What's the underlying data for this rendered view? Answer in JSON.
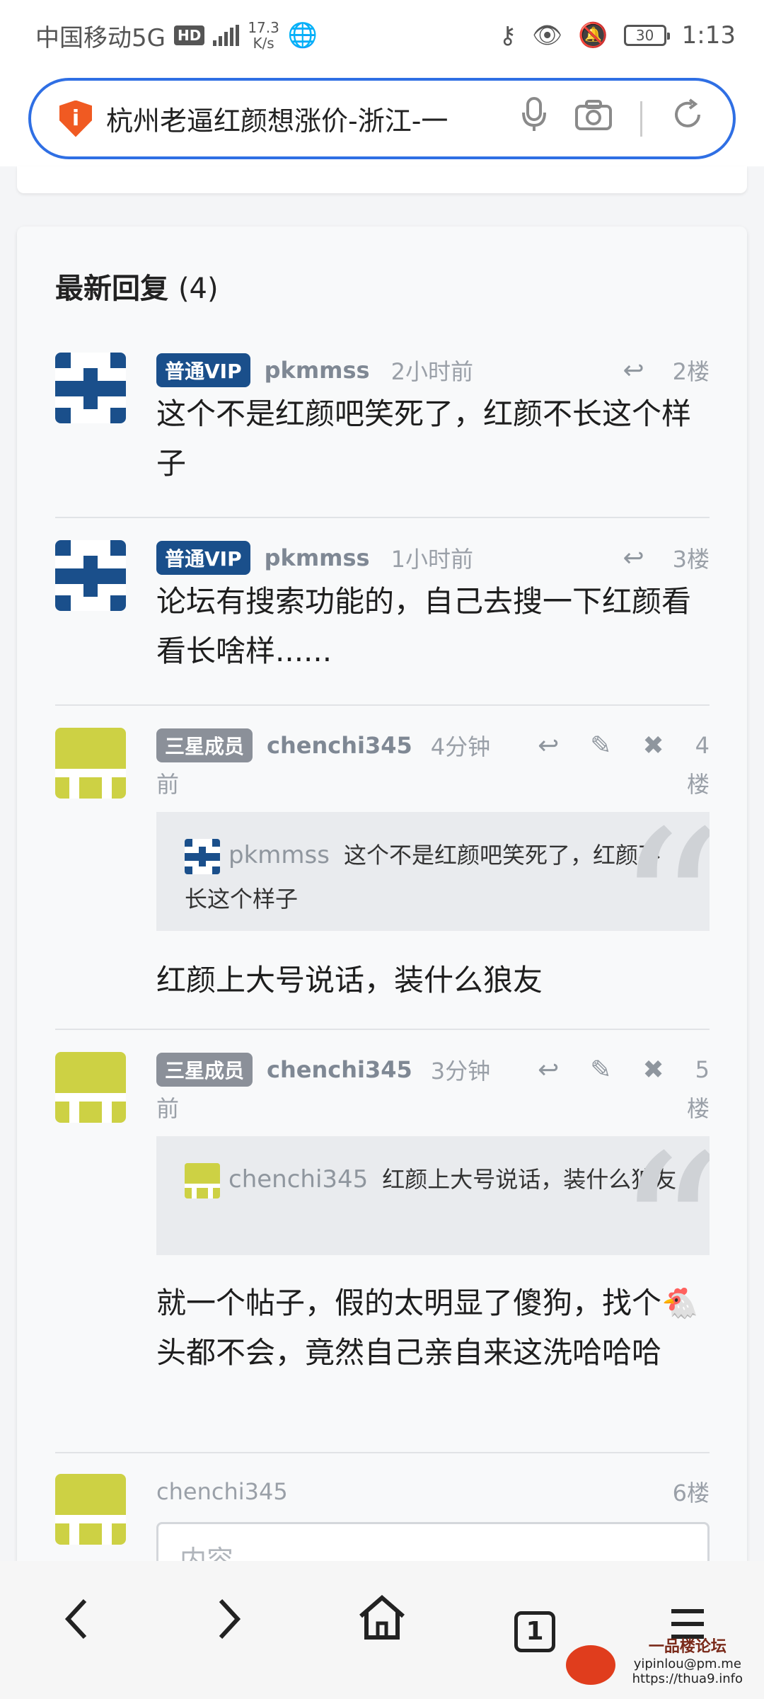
{
  "status": {
    "carrier": "中国移动5G",
    "hd": "HD",
    "net_speed_value": "17.3",
    "net_speed_unit": "K/s",
    "battery": "30",
    "time": "1:13"
  },
  "address_bar": {
    "url_title": "杭州老逼红颜想涨价-浙江-一"
  },
  "replies": {
    "title": "最新回复",
    "count": "(4)"
  },
  "posts": [
    {
      "badge": "普通VIP",
      "user": "pkmmss",
      "time": "2小时前",
      "floor": "2楼",
      "text": "这个不是红颜吧笑死了，红颜不长这个样子"
    },
    {
      "badge": "普通VIP",
      "user": "pkmmss",
      "time": "1小时前",
      "floor": "3楼",
      "text": "论坛有搜索功能的，自己去搜一下红颜看看长啥样......"
    },
    {
      "badge": "三星成员",
      "user": "chenchi345",
      "time_a": "4分钟",
      "time_b": "前",
      "floor_a": "4",
      "floor_b": "楼",
      "quote_user": "pkmmss",
      "quote_text": "这个不是红颜吧笑死了，红颜不长这个样子",
      "text": "红颜上大号说话，装什么狼友"
    },
    {
      "badge": "三星成员",
      "user": "chenchi345",
      "time_a": "3分钟",
      "time_b": "前",
      "floor_a": "5",
      "floor_b": "楼",
      "quote_user": "chenchi345",
      "quote_text": "红颜上大号说话，装什么狼友",
      "text": "就一个帖子，假的太明显了傻狗，找个🐔头都不会，竟然自己亲自来这洗哈哈哈"
    }
  ],
  "composer": {
    "user": "chenchi345",
    "floor": "6楼",
    "placeholder": "内容"
  },
  "bottom_nav": {
    "tab_count": "1"
  },
  "watermark": {
    "title": "一品楼论坛",
    "email": "yipinlou@pm.me",
    "url": "https://thua9.info"
  }
}
